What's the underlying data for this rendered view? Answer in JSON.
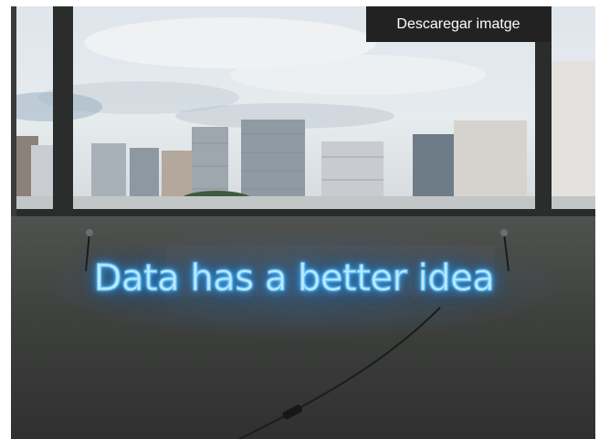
{
  "download_button": {
    "label": "Descaregar imatge"
  },
  "photo": {
    "neon_sign_text": "Data has a better idea"
  },
  "colors": {
    "button_bg": "#222222",
    "button_text": "#ffffff",
    "neon": "#66c6ff",
    "wall": "#3a3c3a"
  }
}
